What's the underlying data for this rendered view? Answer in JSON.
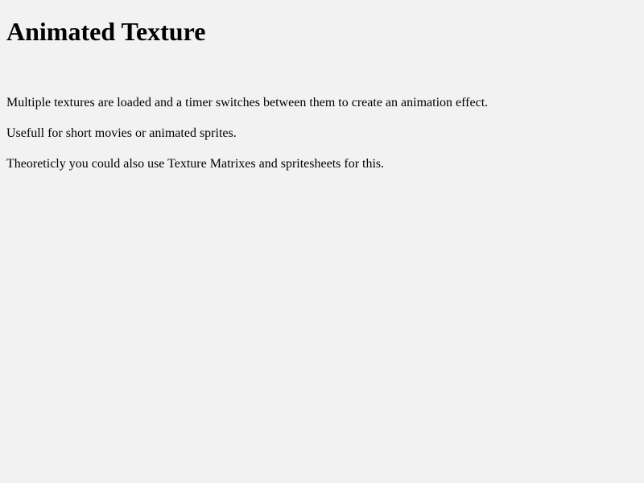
{
  "page": {
    "title": "Animated Texture",
    "paragraphs": [
      "Multiple textures are loaded and a timer switches between them to create an animation effect.",
      "Usefull for short movies or animated sprites.",
      "Theoreticly you could also use Texture Matrixes and spritesheets for this."
    ]
  },
  "colors": {
    "background": "#f2f2f2",
    "text": "#000000"
  }
}
